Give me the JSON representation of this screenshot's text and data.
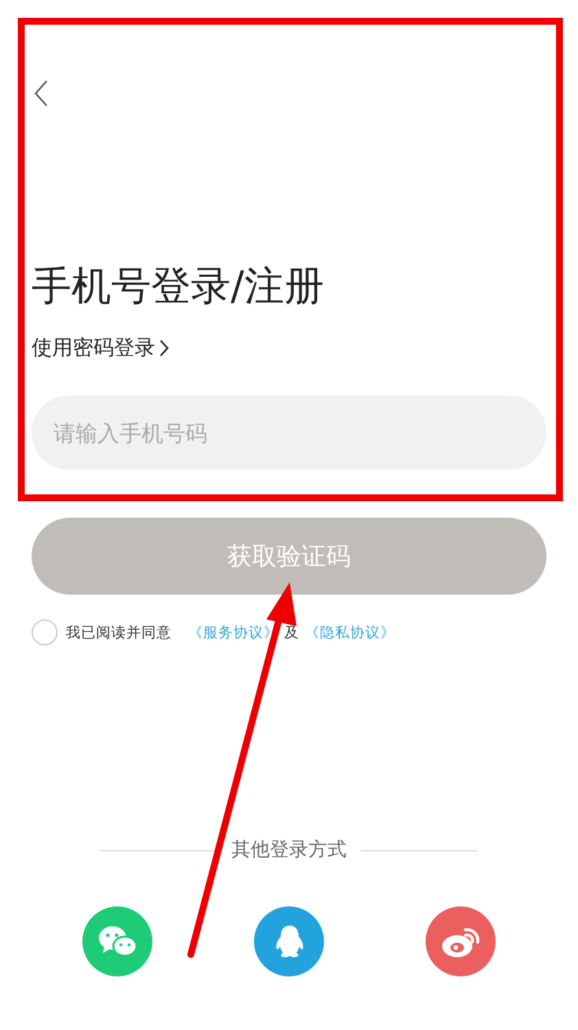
{
  "title": "手机号登录/注册",
  "password_login_link": "使用密码登录",
  "phone_field": {
    "placeholder": "请输入手机号码"
  },
  "submit_button": {
    "label": "获取验证码",
    "disabled": true
  },
  "agreement": {
    "checked": false,
    "text": "我已阅读并同意",
    "links": [
      "《服务协议》",
      "《隐私协议》"
    ],
    "joiner": "及"
  },
  "other_login": {
    "label": "其他登录方式",
    "methods": [
      {
        "kind": "wechat",
        "color": "#1ecb76"
      },
      {
        "kind": "qq",
        "color": "#22a3dd"
      },
      {
        "kind": "weibo",
        "color": "#eb5f5f"
      }
    ]
  }
}
